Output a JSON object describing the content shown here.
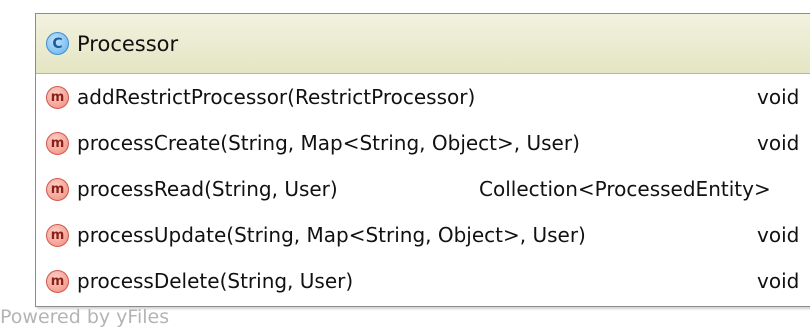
{
  "class": {
    "icon_letter": "C",
    "name": "Processor"
  },
  "methods": [
    {
      "icon_letter": "m",
      "signature": "addRestrictProcessor(RestrictProcessor)",
      "return_type": "void"
    },
    {
      "icon_letter": "m",
      "signature": "processCreate(String, Map<String, Object>, User)",
      "return_type": "void"
    },
    {
      "icon_letter": "m",
      "signature": "processRead(String, User)",
      "return_type": "Collection<ProcessedEntity>"
    },
    {
      "icon_letter": "m",
      "signature": "processUpdate(String, Map<String, Object>, User)",
      "return_type": "void"
    },
    {
      "icon_letter": "m",
      "signature": "processDelete(String, User)",
      "return_type": "void"
    }
  ],
  "watermark": "Powered by yFiles",
  "colors": {
    "header_bg": "#e4e5c3",
    "class_icon": "#63b0ea",
    "method_icon": "#f08a7c"
  }
}
